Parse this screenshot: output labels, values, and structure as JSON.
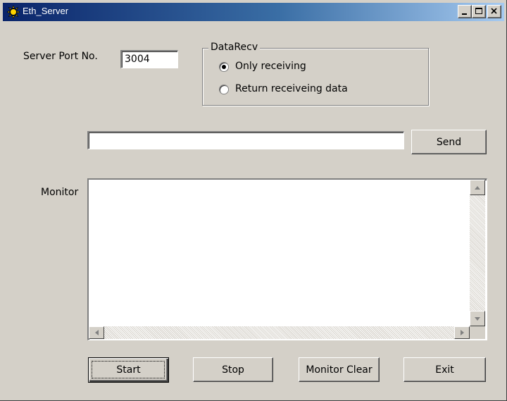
{
  "window": {
    "title": "Eth_Server",
    "controls": [
      "minimize-icon",
      "maximize-icon",
      "close-icon"
    ]
  },
  "server": {
    "port_label": "Server Port No.",
    "port_value": "3004"
  },
  "data_recv": {
    "legend": "DataRecv",
    "options": [
      {
        "label": "Only receiving",
        "selected": true
      },
      {
        "label": "Return receiveing data",
        "selected": false
      }
    ]
  },
  "send": {
    "input_value": "",
    "button_label": "Send"
  },
  "monitor": {
    "label": "Monitor",
    "content": ""
  },
  "buttons": {
    "start": "Start",
    "stop": "Stop",
    "monitor_clear": "Monitor Clear",
    "exit": "Exit"
  },
  "colors": {
    "titlebar_start": "#0a246a",
    "titlebar_end": "#a6caf0",
    "face": "#d4d0c8"
  }
}
